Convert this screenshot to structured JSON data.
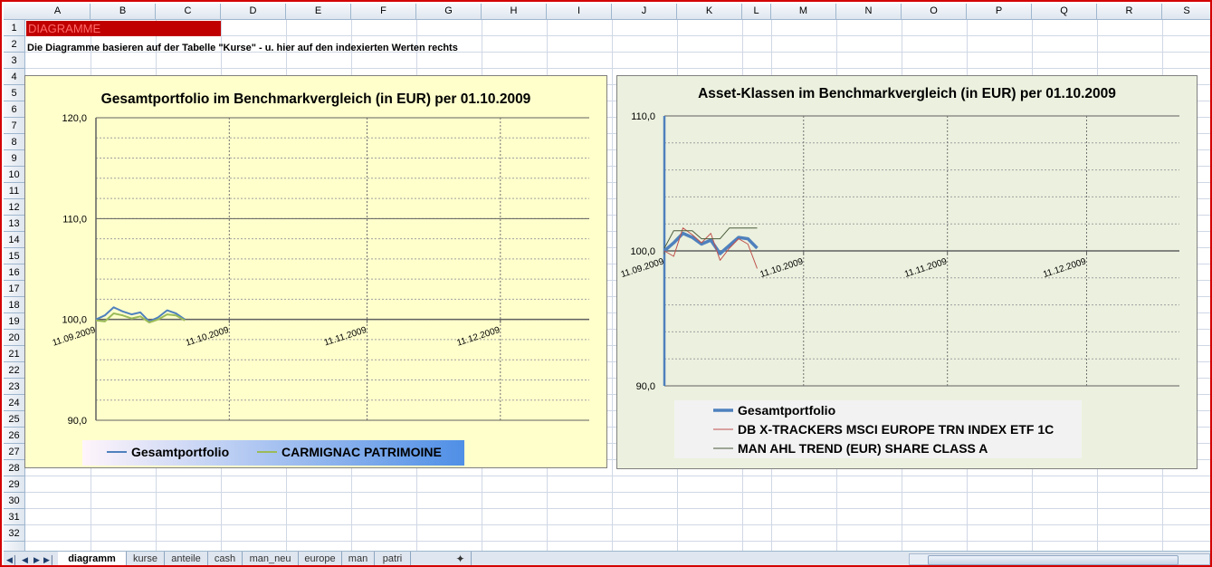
{
  "columns": [
    "A",
    "B",
    "C",
    "D",
    "E",
    "F",
    "G",
    "H",
    "I",
    "J",
    "K",
    "L",
    "M",
    "N",
    "O",
    "P",
    "Q",
    "R",
    "S"
  ],
  "rows": [
    "1",
    "2",
    "3",
    "4",
    "5",
    "6",
    "7",
    "8",
    "9",
    "10",
    "11",
    "12",
    "13",
    "14",
    "15",
    "16",
    "17",
    "18",
    "19",
    "20",
    "21",
    "22",
    "23",
    "24",
    "25",
    "26",
    "27",
    "28",
    "29",
    "30",
    "31",
    "32"
  ],
  "cells": {
    "a1": "DIAGRAMME",
    "a2": "Die Diagramme basieren auf der Tabelle \"Kurse\" - u. hier auf den indexierten Werten rechts"
  },
  "sheet_tabs": [
    "diagramm",
    "kurse",
    "anteile",
    "cash",
    "man_neu",
    "europe",
    "man",
    "patri"
  ],
  "active_tab": "diagramm",
  "nav_icons": [
    "first-sheet-icon",
    "prev-sheet-icon",
    "next-sheet-icon",
    "last-sheet-icon"
  ],
  "colors": {
    "frame": "#d40000",
    "chart1_bg": "#ffffcc",
    "chart2_bg": "#ebf1de",
    "series_blue": "#4f81bd",
    "series_green": "#9bbb59",
    "series_red": "#c0504d",
    "series_dark": "#4a5a3a"
  },
  "chart_data": [
    {
      "type": "line",
      "title": "Gesamtportfolio im Benchmarkvergleich (in EUR) per 01.10.2009",
      "ylim": [
        90,
        120
      ],
      "yticks": [
        "120,0",
        "110,0",
        "100,0",
        "90,0"
      ],
      "x_start": "2009-09-11",
      "x_end": "2009-12-31",
      "x_tick_labels": [
        "11.09.2009",
        "11.10.2009",
        "11.11.2009",
        "11.12.2009"
      ],
      "grid": true,
      "legend_position": "bottom",
      "x": [
        "2009-09-11",
        "2009-09-13",
        "2009-09-15",
        "2009-09-17",
        "2009-09-19",
        "2009-09-21",
        "2009-09-23",
        "2009-09-25",
        "2009-09-27",
        "2009-09-29",
        "2009-10-01"
      ],
      "series": [
        {
          "name": "Gesamtportfolio",
          "color": "#4f81bd",
          "width": 2,
          "values": [
            100.0,
            100.4,
            101.2,
            100.8,
            100.5,
            100.7,
            99.8,
            100.2,
            100.9,
            100.6,
            100.0
          ]
        },
        {
          "name": "CARMIGNAC PATRIMOINE",
          "color": "#9bbb59",
          "width": 2,
          "values": [
            99.9,
            99.8,
            100.6,
            100.4,
            100.1,
            100.3,
            99.7,
            100.0,
            100.5,
            100.4,
            99.9
          ]
        }
      ]
    },
    {
      "type": "line",
      "title": "Asset-Klassen im Benchmarkvergleich (in EUR) per 01.10.2009",
      "ylim": [
        90,
        110
      ],
      "yticks": [
        "110,0",
        "100,0",
        "90,0"
      ],
      "x_start": "2009-09-11",
      "x_end": "2009-12-31",
      "x_tick_labels": [
        "11.09.2009",
        "11.10.2009",
        "11.11.2009",
        "11.12.2009"
      ],
      "grid": true,
      "legend_position": "bottom",
      "x": [
        "2009-09-11",
        "2009-09-13",
        "2009-09-15",
        "2009-09-17",
        "2009-09-19",
        "2009-09-21",
        "2009-09-23",
        "2009-09-25",
        "2009-09-27",
        "2009-09-29",
        "2009-10-01"
      ],
      "series": [
        {
          "name": "Gesamtportfolio",
          "color": "#4f81bd",
          "width": 3.5,
          "values": [
            100.0,
            100.6,
            101.3,
            101.0,
            100.5,
            100.8,
            99.8,
            100.4,
            101.0,
            100.9,
            100.2
          ]
        },
        {
          "name": "DB X-TRACKERS MSCI EUROPE TRN INDEX ETF 1C",
          "color": "#c0504d",
          "width": 1,
          "values": [
            100.0,
            99.6,
            101.7,
            101.2,
            100.6,
            101.3,
            99.3,
            100.2,
            100.9,
            100.5,
            98.7
          ]
        },
        {
          "name": "MAN AHL TREND (EUR) SHARE CLASS A",
          "color": "#4a5a3a",
          "width": 1,
          "values": [
            100.2,
            101.5,
            101.5,
            101.5,
            100.9,
            100.9,
            100.9,
            101.7,
            101.7,
            101.7,
            101.7
          ]
        }
      ]
    }
  ]
}
